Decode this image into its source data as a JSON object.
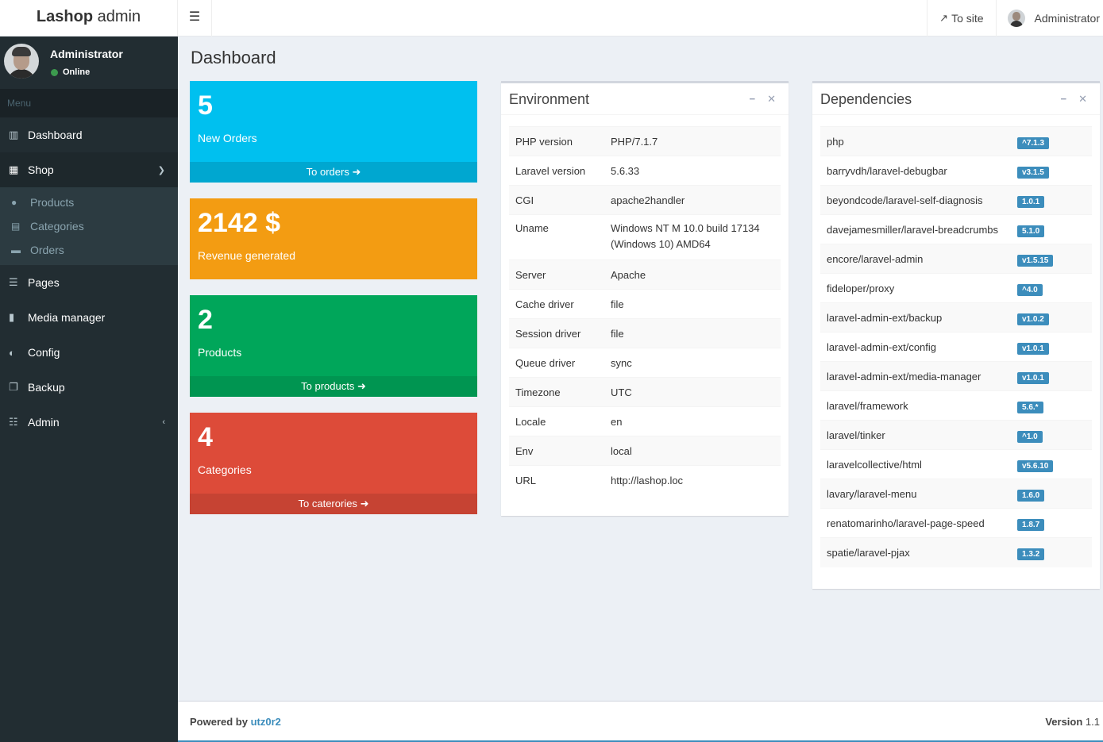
{
  "header": {
    "logo_bold": "Lashop",
    "logo_rest": " admin",
    "toggle_icon": "☰",
    "to_site": "To site",
    "user": "Administrator"
  },
  "sidebar": {
    "user_name": "Administrator",
    "user_status": "Online",
    "menu_header": "Menu",
    "items": [
      {
        "label": "Dashboard",
        "icon": "bar-chart-icon"
      },
      {
        "label": "Shop",
        "icon": "shopping-basket-icon"
      },
      {
        "label": "Pages",
        "icon": "list-alt-icon"
      },
      {
        "label": "Media manager",
        "icon": "file-icon"
      },
      {
        "label": "Config",
        "icon": "toggle-icon"
      },
      {
        "label": "Backup",
        "icon": "copy-icon"
      },
      {
        "label": "Admin",
        "icon": "tasks-icon"
      }
    ],
    "shop_sub": [
      {
        "label": "Products",
        "icon": "product-hunt-icon"
      },
      {
        "label": "Categories",
        "icon": "building-icon"
      },
      {
        "label": "Orders",
        "icon": "cart-icon"
      }
    ]
  },
  "page_title": "Dashboard",
  "stats": [
    {
      "value": "5",
      "label": "New Orders",
      "footer": "To orders",
      "color": "#00c0ef",
      "footer_color": "#00a7d0"
    },
    {
      "value": "2142 $",
      "label": "Revenue generated",
      "footer": "",
      "color": "#f39c12",
      "footer_color": "#f39c12"
    },
    {
      "value": "2",
      "label": "Products",
      "footer": "To products",
      "color": "#00a65a",
      "footer_color": "#009551"
    },
    {
      "value": "4",
      "label": "Categories",
      "footer": "To caterories",
      "color": "#dd4b39",
      "footer_color": "#c64333"
    }
  ],
  "environment": {
    "title": "Environment",
    "rows": [
      {
        "k": "PHP version",
        "v": "PHP/7.1.7"
      },
      {
        "k": "Laravel version",
        "v": "5.6.33"
      },
      {
        "k": "CGI",
        "v": "apache2handler"
      },
      {
        "k": "Uname",
        "v": "Windows NT M 10.0 build 17134 (Windows 10) AMD64"
      },
      {
        "k": "Server",
        "v": "Apache"
      },
      {
        "k": "Cache driver",
        "v": "file"
      },
      {
        "k": "Session driver",
        "v": "file"
      },
      {
        "k": "Queue driver",
        "v": "sync"
      },
      {
        "k": "Timezone",
        "v": "UTC"
      },
      {
        "k": "Locale",
        "v": "en"
      },
      {
        "k": "Env",
        "v": "local"
      },
      {
        "k": "URL",
        "v": "http://lashop.loc"
      }
    ]
  },
  "dependencies": {
    "title": "Dependencies",
    "rows": [
      {
        "k": "php",
        "v": "^7.1.3"
      },
      {
        "k": "barryvdh/laravel-debugbar",
        "v": "v3.1.5"
      },
      {
        "k": "beyondcode/laravel-self-diagnosis",
        "v": "1.0.1"
      },
      {
        "k": "davejamesmiller/laravel-breadcrumbs",
        "v": "5.1.0"
      },
      {
        "k": "encore/laravel-admin",
        "v": "v1.5.15"
      },
      {
        "k": "fideloper/proxy",
        "v": "^4.0"
      },
      {
        "k": "laravel-admin-ext/backup",
        "v": "v1.0.2"
      },
      {
        "k": "laravel-admin-ext/config",
        "v": "v1.0.1"
      },
      {
        "k": "laravel-admin-ext/media-manager",
        "v": "v1.0.1"
      },
      {
        "k": "laravel/framework",
        "v": "5.6.*"
      },
      {
        "k": "laravel/tinker",
        "v": "^1.0"
      },
      {
        "k": "laravelcollective/html",
        "v": "v5.6.10"
      },
      {
        "k": "lavary/laravel-menu",
        "v": "1.6.0"
      },
      {
        "k": "renatomarinho/laravel-page-speed",
        "v": "1.8.7"
      },
      {
        "k": "spatie/laravel-pjax",
        "v": "1.3.2"
      }
    ]
  },
  "footer": {
    "powered_by": "Powered by",
    "author": "utz0r2",
    "version_label": "Version",
    "version": "1.1"
  }
}
